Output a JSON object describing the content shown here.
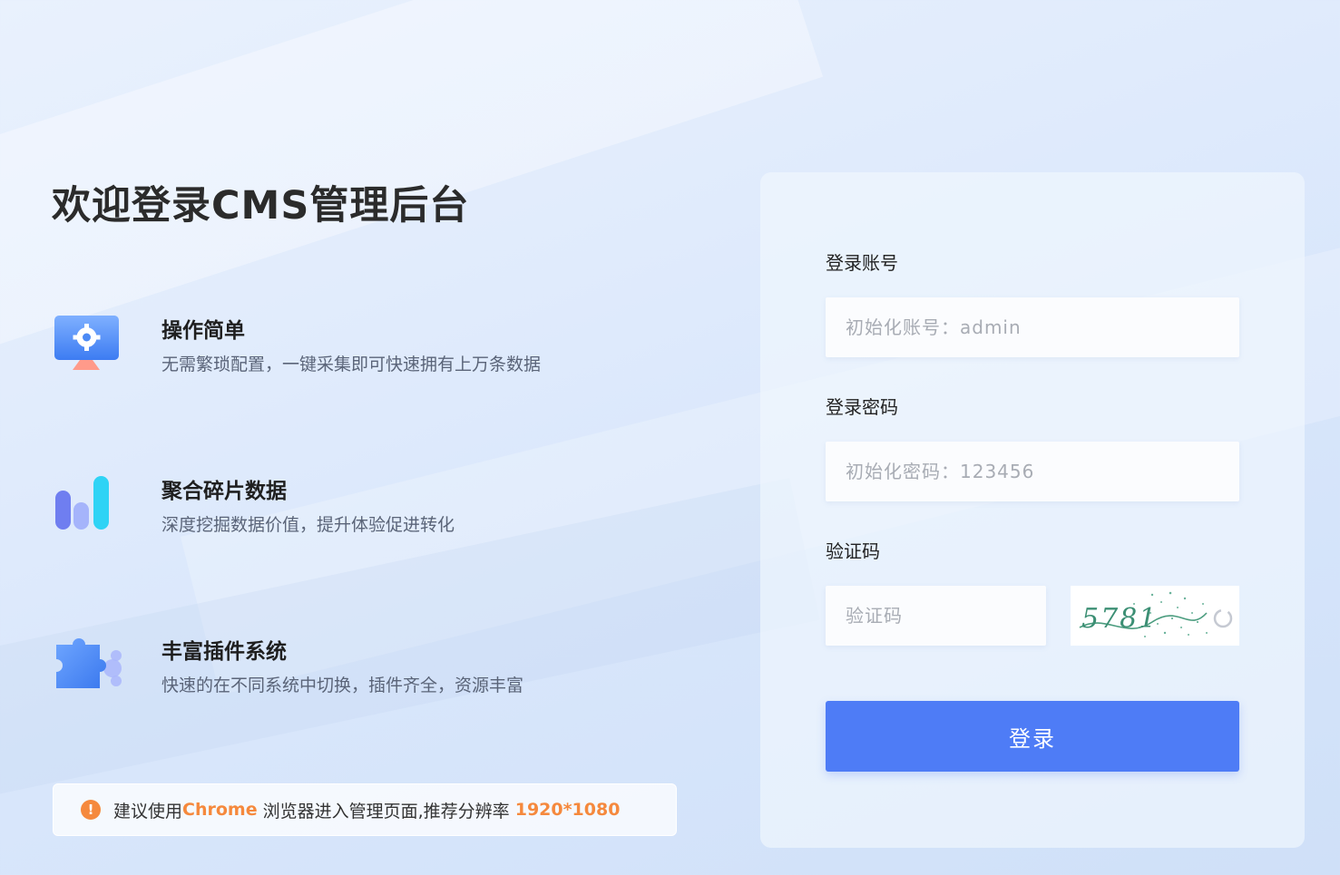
{
  "hero": {
    "title": "欢迎登录CMS管理后台"
  },
  "features": [
    {
      "icon": "monitor-gear-icon",
      "title": "操作简单",
      "desc": "无需繁琐配置，一键采集即可快速拥有上万条数据"
    },
    {
      "icon": "bar-chart-icon",
      "title": "聚合碎片数据",
      "desc": "深度挖掘数据价值，提升体验促进转化"
    },
    {
      "icon": "puzzle-icon",
      "title": "丰富插件系统",
      "desc": "快速的在不同系统中切换，插件齐全，资源丰富"
    }
  ],
  "notice": {
    "icon": "warning-icon",
    "prefix": "建议使用",
    "browser": "Chrome",
    "middle": " 浏览器进入管理页面,推荐分辨率 ",
    "resolution": "1920*1080"
  },
  "login": {
    "account_label": "登录账号",
    "account_placeholder": "初始化账号：admin",
    "password_label": "登录密码",
    "password_placeholder": "初始化密码：123456",
    "captcha_label": "验证码",
    "captcha_placeholder": "验证码",
    "captcha_text": "5781",
    "submit_label": "登录"
  },
  "colors": {
    "accent": "#4e7cf6",
    "warning": "#f5893d"
  }
}
